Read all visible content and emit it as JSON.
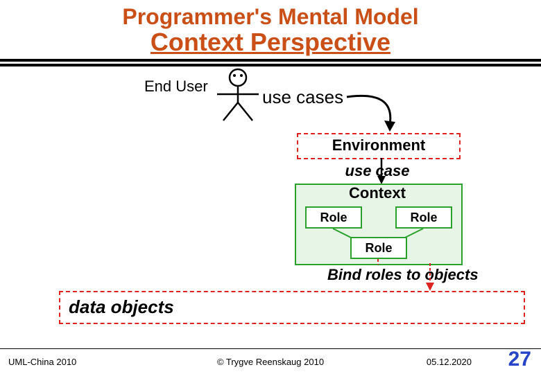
{
  "title": {
    "line1": "Programmer's Mental Model",
    "line2": "Context Perspective"
  },
  "labels": {
    "end_user": "End User",
    "use_cases": "use cases",
    "environment": "Environment",
    "use_case": "use case",
    "context": "Context",
    "role": "Role",
    "bind": "Bind roles to objects",
    "data_objects": "data objects"
  },
  "footer": {
    "left": "UML-China 2010",
    "center": "© Trygve Reenskaug 2010",
    "date": "05.12.2020",
    "page": "27"
  }
}
